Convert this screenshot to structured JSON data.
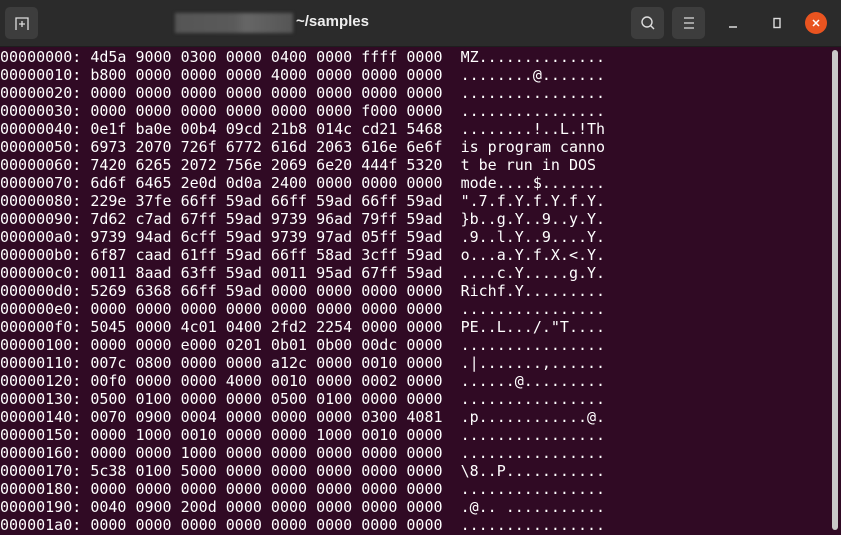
{
  "window": {
    "title": "~/samples"
  },
  "icons": {
    "new_tab": "new-tab-icon",
    "search": "search-icon",
    "menu": "hamburger-menu-icon",
    "minimize": "minimize-icon",
    "maximize": "maximize-icon",
    "close": "close-icon"
  },
  "colors": {
    "background": "#300a24",
    "titlebar": "#2b2b2b",
    "close": "#e95420",
    "text": "#ffffff"
  },
  "lines": [
    {
      "offset": "00000000:",
      "hex": "4d5a 9000 0300 0000 0400 0000 ffff 0000",
      "ascii": "MZ.............."
    },
    {
      "offset": "00000010:",
      "hex": "b800 0000 0000 0000 4000 0000 0000 0000",
      "ascii": "........@......."
    },
    {
      "offset": "00000020:",
      "hex": "0000 0000 0000 0000 0000 0000 0000 0000",
      "ascii": "................"
    },
    {
      "offset": "00000030:",
      "hex": "0000 0000 0000 0000 0000 0000 f000 0000",
      "ascii": "................"
    },
    {
      "offset": "00000040:",
      "hex": "0e1f ba0e 00b4 09cd 21b8 014c cd21 5468",
      "ascii": "........!..L.!Th"
    },
    {
      "offset": "00000050:",
      "hex": "6973 2070 726f 6772 616d 2063 616e 6e6f",
      "ascii": "is program canno"
    },
    {
      "offset": "00000060:",
      "hex": "7420 6265 2072 756e 2069 6e20 444f 5320",
      "ascii": "t be run in DOS "
    },
    {
      "offset": "00000070:",
      "hex": "6d6f 6465 2e0d 0d0a 2400 0000 0000 0000",
      "ascii": "mode....$......."
    },
    {
      "offset": "00000080:",
      "hex": "229e 37fe 66ff 59ad 66ff 59ad 66ff 59ad",
      "ascii": "\".7.f.Y.f.Y.f.Y."
    },
    {
      "offset": "00000090:",
      "hex": "7d62 c7ad 67ff 59ad 9739 96ad 79ff 59ad",
      "ascii": "}b..g.Y..9..y.Y."
    },
    {
      "offset": "000000a0:",
      "hex": "9739 94ad 6cff 59ad 9739 97ad 05ff 59ad",
      "ascii": ".9..l.Y..9....Y."
    },
    {
      "offset": "000000b0:",
      "hex": "6f87 caad 61ff 59ad 66ff 58ad 3cff 59ad",
      "ascii": "o...a.Y.f.X.<.Y."
    },
    {
      "offset": "000000c0:",
      "hex": "0011 8aad 63ff 59ad 0011 95ad 67ff 59ad",
      "ascii": "....c.Y.....g.Y."
    },
    {
      "offset": "000000d0:",
      "hex": "5269 6368 66ff 59ad 0000 0000 0000 0000",
      "ascii": "Richf.Y........."
    },
    {
      "offset": "000000e0:",
      "hex": "0000 0000 0000 0000 0000 0000 0000 0000",
      "ascii": "................"
    },
    {
      "offset": "000000f0:",
      "hex": "5045 0000 4c01 0400 2fd2 2254 0000 0000",
      "ascii": "PE..L.../.\"T...."
    },
    {
      "offset": "00000100:",
      "hex": "0000 0000 e000 0201 0b01 0b00 00dc 0000",
      "ascii": "................"
    },
    {
      "offset": "00000110:",
      "hex": "007c 0800 0000 0000 a12c 0000 0010 0000",
      "ascii": ".|.......,......"
    },
    {
      "offset": "00000120:",
      "hex": "00f0 0000 0000 4000 0010 0000 0002 0000",
      "ascii": "......@........."
    },
    {
      "offset": "00000130:",
      "hex": "0500 0100 0000 0000 0500 0100 0000 0000",
      "ascii": "................"
    },
    {
      "offset": "00000140:",
      "hex": "0070 0900 0004 0000 0000 0000 0300 4081",
      "ascii": ".p............@."
    },
    {
      "offset": "00000150:",
      "hex": "0000 1000 0010 0000 0000 1000 0010 0000",
      "ascii": "................"
    },
    {
      "offset": "00000160:",
      "hex": "0000 0000 1000 0000 0000 0000 0000 0000",
      "ascii": "................"
    },
    {
      "offset": "00000170:",
      "hex": "5c38 0100 5000 0000 0000 0000 0000 0000",
      "ascii": "\\8..P..........."
    },
    {
      "offset": "00000180:",
      "hex": "0000 0000 0000 0000 0000 0000 0000 0000",
      "ascii": "................"
    },
    {
      "offset": "00000190:",
      "hex": "0040 0900 200d 0000 0000 0000 0000 0000",
      "ascii": ".@.. ..........."
    },
    {
      "offset": "000001a0:",
      "hex": "0000 0000 0000 0000 0000 0000 0000 0000",
      "ascii": "................"
    }
  ]
}
